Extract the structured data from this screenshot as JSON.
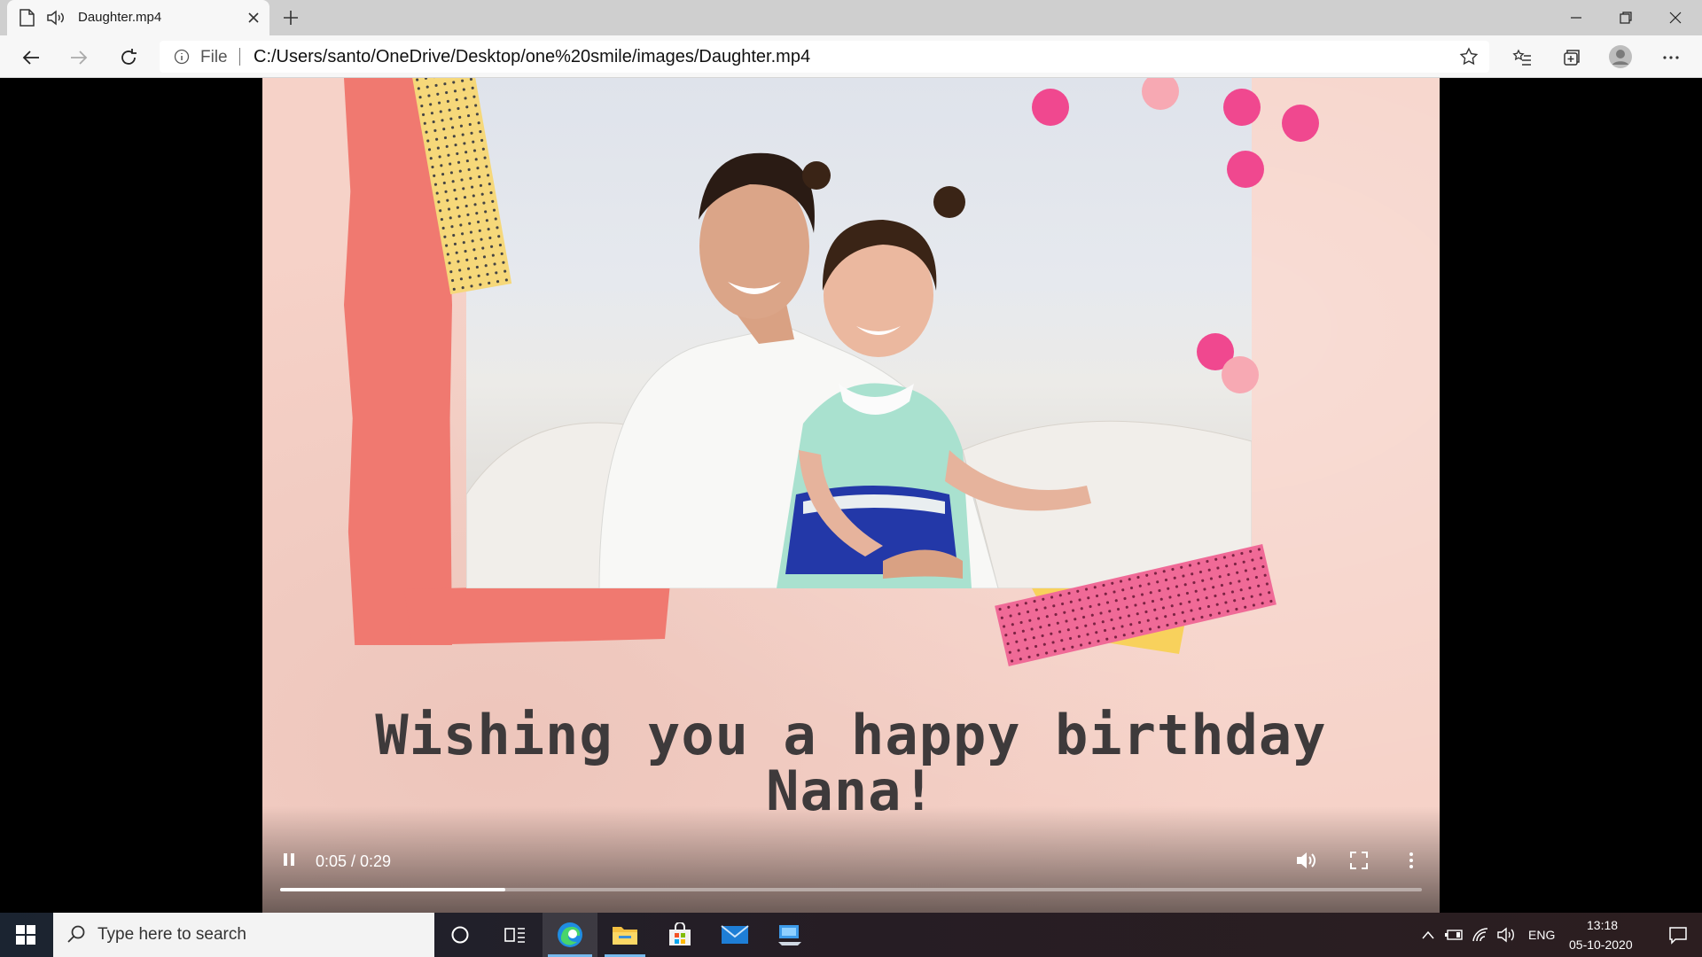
{
  "browser": {
    "tab": {
      "title": "Daughter.mp4"
    },
    "address": {
      "scheme_label": "File",
      "url": "C:/Users/santo/OneDrive/Desktop/one%20smile/images/Daughter.mp4"
    }
  },
  "video": {
    "caption_line1": "Wishing you a happy birthday",
    "caption_line2": "Nana!",
    "time_display": "0:05 / 0:29",
    "progress_fraction": 0.197,
    "state": "playing",
    "colors": {
      "coral": "#f07970",
      "yellow": "#f8d15c",
      "pink_dot": "#f0488f",
      "paper": "#f6d2c8"
    }
  },
  "taskbar": {
    "search_placeholder": "Type here to search",
    "language": "ENG",
    "time": "13:18",
    "date": "05-10-2020"
  }
}
